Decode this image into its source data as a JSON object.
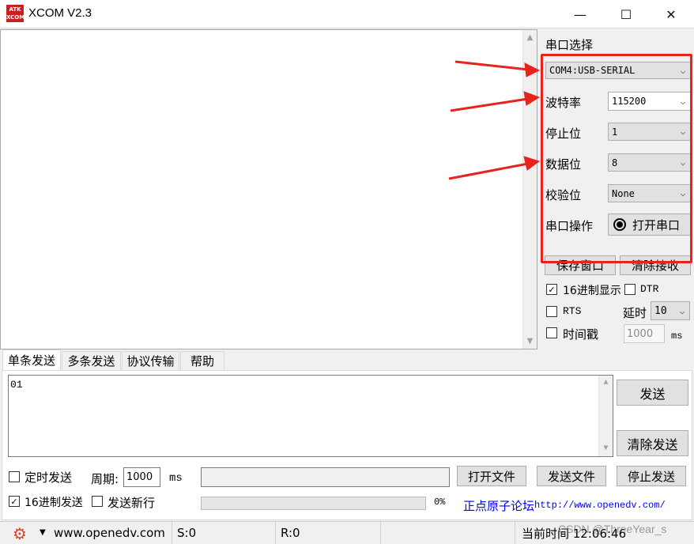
{
  "window": {
    "title": "XCOM V2.3",
    "logo_text": "ATK XCOM",
    "minimize": "—",
    "maximize": "☐",
    "close": "✕"
  },
  "serial": {
    "section_title": "串口选择",
    "port_value": "COM4:USB-SERIAL",
    "baud_label": "波特率",
    "baud_value": "115200",
    "stop_label": "停止位",
    "stop_value": "1",
    "data_label": "数据位",
    "data_value": "8",
    "parity_label": "校验位",
    "parity_value": "None",
    "op_label": "串口操作",
    "open_button": "打开串口"
  },
  "recv_controls": {
    "save_window": "保存窗口",
    "clear_recv": "清除接收",
    "hex_display": "16进制显示",
    "dtr": "DTR",
    "rts": "RTS",
    "delay_label": "延时",
    "delay_value": "10",
    "timestamp": "时间戳",
    "timestamp_value": "1000",
    "ms": "ms"
  },
  "tabs": [
    "单条发送",
    "多条发送",
    "协议传输",
    "帮助"
  ],
  "send": {
    "text": "01",
    "send_button": "发送",
    "clear_send_button": "清除发送",
    "timed_send": "定时发送",
    "period_label": "周期:",
    "period_value": "1000",
    "period_unit": "ms",
    "open_file": "打开文件",
    "send_file": "发送文件",
    "stop_send": "停止发送",
    "hex_send": "16进制发送",
    "send_newline": "发送新行",
    "progress": "0%",
    "forum_text": "正点原子论坛",
    "forum_url": "http://www.openedv.com/"
  },
  "status": {
    "url": "www.openedv.com",
    "s": "S:0",
    "r": "R:0",
    "time": "当前时间 12:06:46",
    "watermark": "CSDN @ThreeYear_s"
  },
  "colors": {
    "annotation": "#e8231c",
    "link": "#0000ff"
  }
}
